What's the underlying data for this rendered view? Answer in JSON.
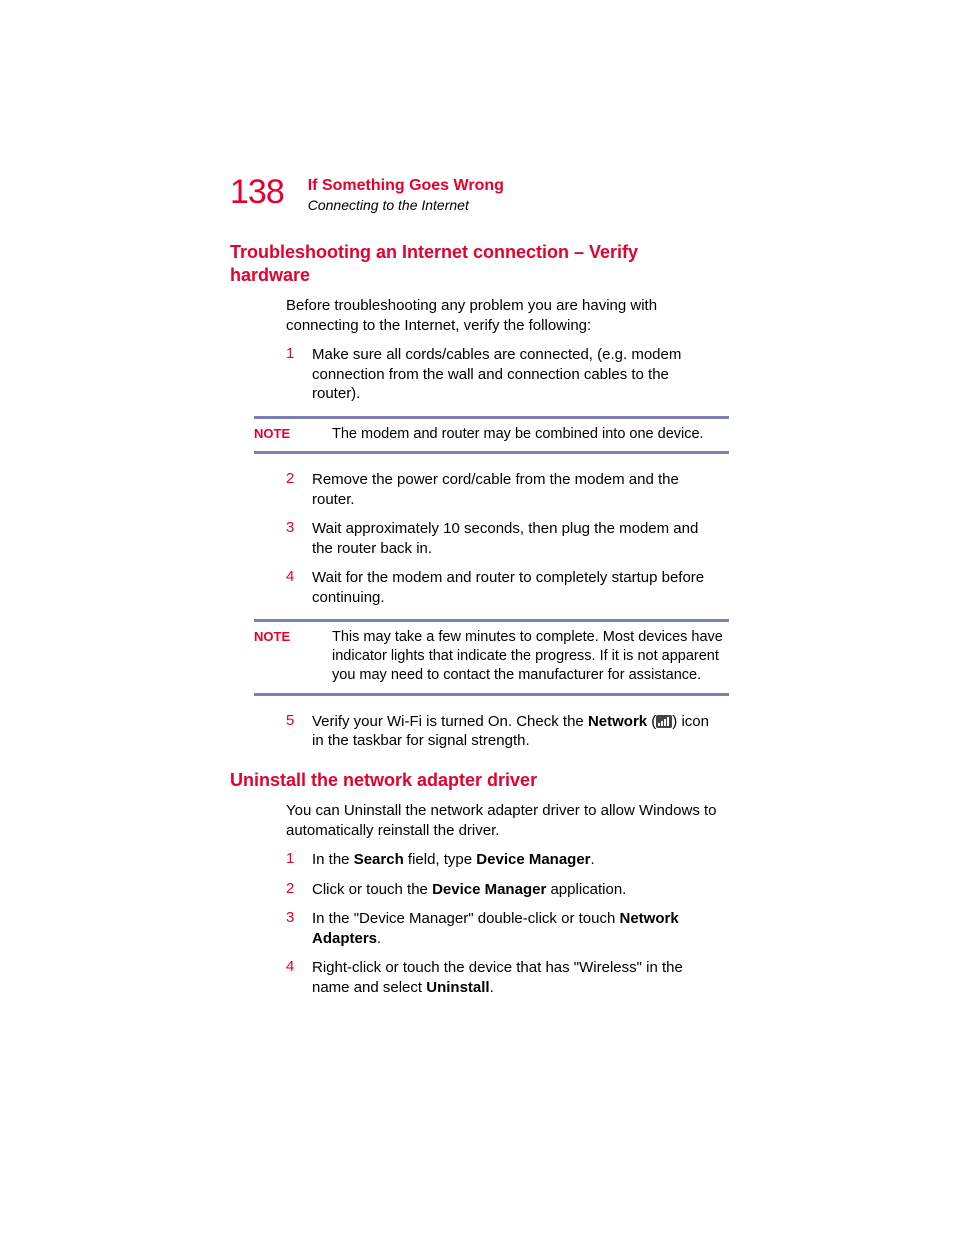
{
  "page_number": "138",
  "header": {
    "chapter": "If Something Goes Wrong",
    "section": "Connecting to the Internet"
  },
  "sec1": {
    "heading": "Troubleshooting an Internet connection – Verify hardware",
    "intro": "Before troubleshooting any problem you are having with connecting to the Internet, verify the following:",
    "step1": {
      "num": "1",
      "text": "Make sure all cords/cables are connected, (e.g. modem connection from the wall and connection cables to the router)."
    },
    "note1": {
      "label": "NOTE",
      "text": "The modem and router may be combined into one device."
    },
    "step2": {
      "num": "2",
      "text": "Remove the power cord/cable from the modem and the router."
    },
    "step3": {
      "num": "3",
      "text": "Wait approximately 10 seconds, then plug the modem and the router back in."
    },
    "step4": {
      "num": "4",
      "text": "Wait for the modem and router to completely startup before continuing."
    },
    "note2": {
      "label": "NOTE",
      "text": "This may take a few minutes to complete. Most devices have indicator lights that indicate the progress. If it is not apparent you may need to contact the manufacturer for assistance."
    },
    "step5": {
      "num": "5",
      "pre": "Verify your Wi-Fi is turned On. Check the ",
      "bold": "Network",
      "open": " (",
      "close": ") icon in the taskbar for signal strength."
    }
  },
  "sec2": {
    "heading": "Uninstall the network adapter driver",
    "intro": "You can Uninstall the network adapter driver to allow Windows to automatically reinstall the driver.",
    "s1": {
      "num": "1",
      "a": "In the ",
      "b": "Search",
      "c": " field, type ",
      "d": "Device Manager",
      "e": "."
    },
    "s2": {
      "num": "2",
      "a": "Click or touch the ",
      "b": "Device Manager",
      "c": " application."
    },
    "s3": {
      "num": "3",
      "a": "In the \"Device Manager\" double-click or touch ",
      "b": "Network Adapters",
      "c": "."
    },
    "s4": {
      "num": "4",
      "a": "Right-click or touch the device that has \"Wireless\" in the name and select ",
      "b": "Uninstall",
      "c": "."
    }
  }
}
